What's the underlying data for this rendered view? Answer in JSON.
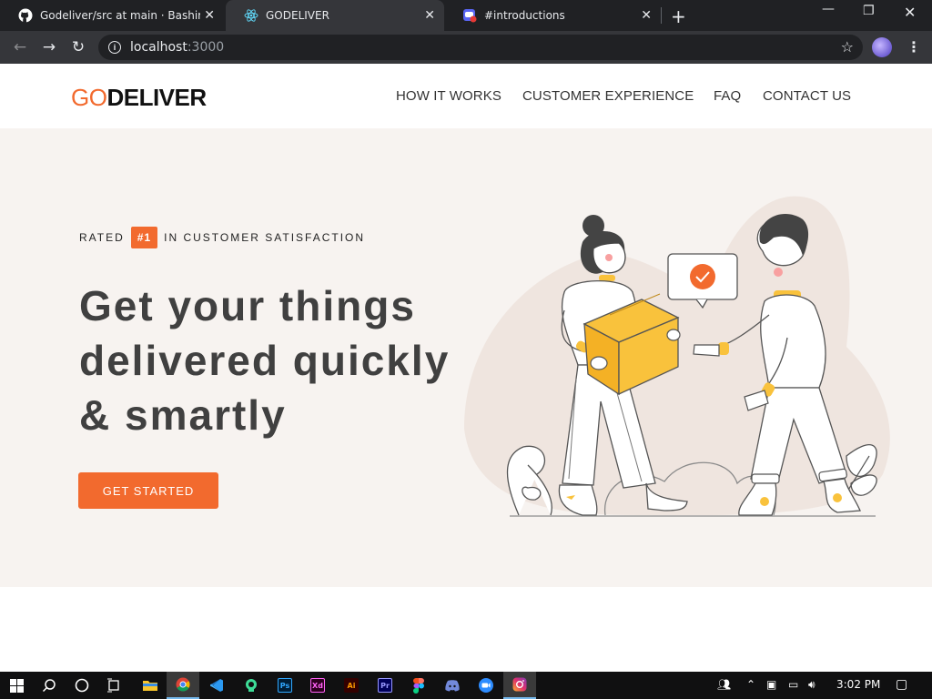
{
  "browser": {
    "tabs": [
      {
        "title": "Godeliver/src at main · BashirMohamed",
        "icon": "github-icon"
      },
      {
        "title": "GODELIVER",
        "icon": "react-icon",
        "active": true
      },
      {
        "title": "#introductions",
        "icon": "discord-notification-icon"
      }
    ],
    "close_glyph": "✕",
    "new_tab_glyph": "+",
    "url_host": "localhost",
    "url_port": ":3000"
  },
  "site": {
    "logo_go": "GO",
    "logo_deliver": "DELIVER",
    "nav": [
      "HOW IT WORKS",
      "CUSTOMER EXPERIENCE",
      "FAQ",
      "CONTACT US"
    ],
    "rated_prefix": "RATED",
    "rated_badge": "#1",
    "rated_suffix": "IN CUSTOMER SATISFACTION",
    "headline_lines": [
      "Get your things",
      "delivered quickly",
      "& smartly"
    ],
    "cta_label": "GET STARTED",
    "colors": {
      "accent": "#f26a2e",
      "hero_bg": "#f7f3f0",
      "box": "#f9c23c"
    }
  },
  "taskbar": {
    "apps": [
      "windows-start-icon",
      "search-icon",
      "cortana-icon",
      "task-view-icon",
      "file-explorer-icon",
      "chrome-icon",
      "vscode-icon",
      "gitkraken-icon",
      "photoshop-icon",
      "xd-icon",
      "illustrator-icon",
      "premiere-icon",
      "figma-icon",
      "discord-icon",
      "zoom-icon",
      "instagram-icon"
    ],
    "ps_label": "Ps",
    "xd_label": "Xd",
    "ai_label": "Ai",
    "pr_label": "Pr",
    "time": "3:02 PM"
  }
}
